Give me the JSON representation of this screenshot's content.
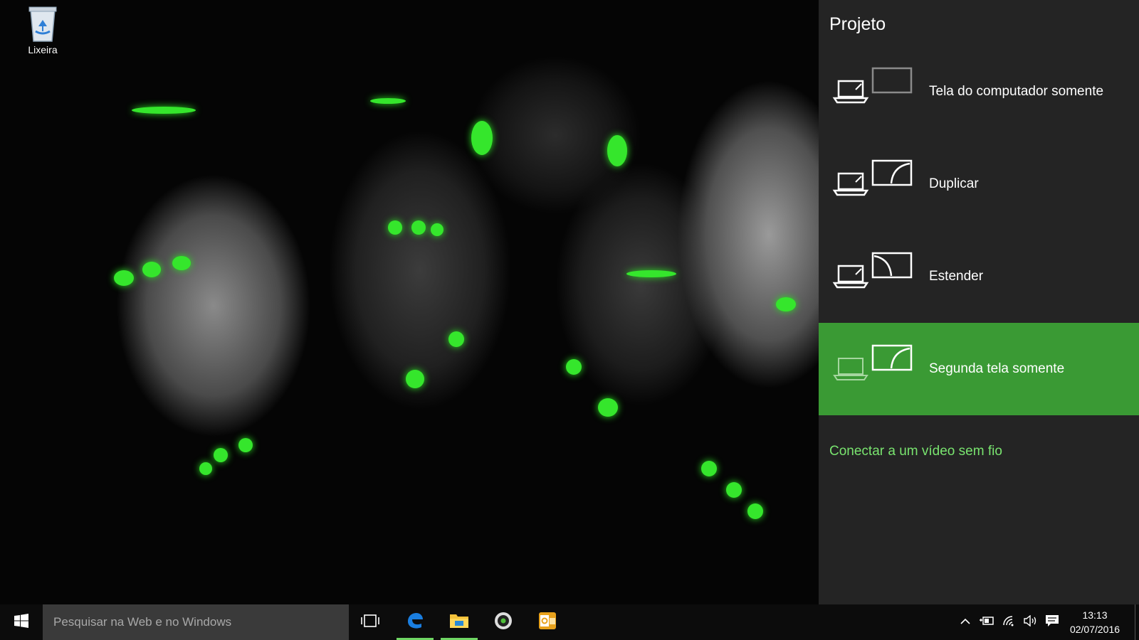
{
  "desktop": {
    "icons": [
      {
        "label": "Lixeira",
        "icon": "recycle-bin-icon"
      }
    ]
  },
  "project_panel": {
    "title": "Projeto",
    "options": [
      {
        "label": "Tela do computador somente",
        "icon": "pc-screen-only-icon",
        "selected": false
      },
      {
        "label": "Duplicar",
        "icon": "duplicate-icon",
        "selected": false
      },
      {
        "label": "Estender",
        "icon": "extend-icon",
        "selected": false
      },
      {
        "label": "Segunda tela somente",
        "icon": "second-screen-only-icon",
        "selected": true
      }
    ],
    "wireless_link": "Conectar a um vídeo sem fio",
    "accent_color": "#3a9a34",
    "link_color": "#79e46f"
  },
  "taskbar": {
    "search_placeholder": "Pesquisar na Web e no Windows",
    "pinned": [
      {
        "icon": "task-view-icon",
        "active": false
      },
      {
        "icon": "edge-icon",
        "active": true
      },
      {
        "icon": "file-explorer-icon",
        "active": true
      },
      {
        "icon": "media-app-icon",
        "active": false
      },
      {
        "icon": "outlook-icon",
        "active": false
      }
    ],
    "tray_icons": [
      "chevron-up-icon",
      "power-icon",
      "wifi-icon",
      "volume-icon",
      "notification-icon"
    ],
    "clock": {
      "time": "13:13",
      "date": "02/07/2016"
    }
  }
}
